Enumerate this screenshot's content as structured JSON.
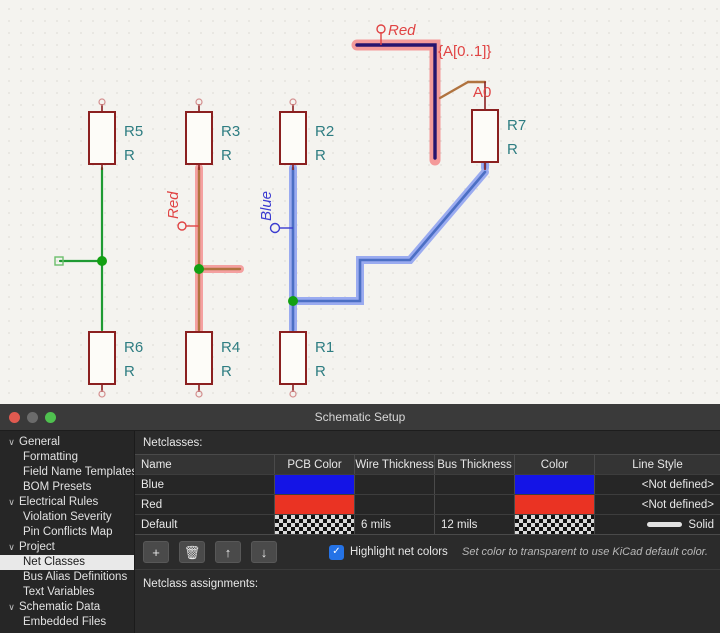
{
  "schematic": {
    "components": [
      {
        "ref": "R5",
        "value": "R"
      },
      {
        "ref": "R3",
        "value": "R"
      },
      {
        "ref": "R2",
        "value": "R"
      },
      {
        "ref": "R7",
        "value": "R"
      },
      {
        "ref": "R6",
        "value": "R"
      },
      {
        "ref": "R4",
        "value": "R"
      },
      {
        "ref": "R1",
        "value": "R"
      }
    ],
    "labels": {
      "red_top": "Red",
      "red_mid": "Red",
      "blue": "Blue",
      "bus": "{A[0..1]}",
      "bus_member": "A0"
    },
    "colors": {
      "background": "#f4f3ef",
      "grid_dot": "#c9c7c0",
      "symbol_outline": "#8b2020",
      "refdes_text": "#2e7d82",
      "net_red": "#e04343",
      "net_blue": "#3b3bd0",
      "wire_green": "#1f9a33",
      "wire_brown": "#b0733f",
      "bus_core": "#26146e",
      "junction_green": "#12a012",
      "blue_wire_highlight": "#6d84e8",
      "red_wire_highlight": "#f4a0a0"
    }
  },
  "dialog": {
    "title": "Schematic Setup",
    "window_controls": [
      "close",
      "minimize",
      "zoom"
    ],
    "sidebar": {
      "items": [
        {
          "label": "General",
          "level": 0,
          "expanded": true,
          "selected": false
        },
        {
          "label": "Formatting",
          "level": 1,
          "expanded": null,
          "selected": false
        },
        {
          "label": "Field Name Templates",
          "level": 1,
          "expanded": null,
          "selected": false
        },
        {
          "label": "BOM Presets",
          "level": 1,
          "expanded": null,
          "selected": false
        },
        {
          "label": "Electrical Rules",
          "level": 0,
          "expanded": true,
          "selected": false
        },
        {
          "label": "Violation Severity",
          "level": 1,
          "expanded": null,
          "selected": false
        },
        {
          "label": "Pin Conflicts Map",
          "level": 1,
          "expanded": null,
          "selected": false
        },
        {
          "label": "Project",
          "level": 0,
          "expanded": true,
          "selected": false
        },
        {
          "label": "Net Classes",
          "level": 1,
          "expanded": null,
          "selected": true
        },
        {
          "label": "Bus Alias Definitions",
          "level": 1,
          "expanded": null,
          "selected": false
        },
        {
          "label": "Text Variables",
          "level": 1,
          "expanded": null,
          "selected": false
        },
        {
          "label": "Schematic Data",
          "level": 0,
          "expanded": true,
          "selected": false
        },
        {
          "label": "Embedded Files",
          "level": 1,
          "expanded": null,
          "selected": false
        }
      ],
      "chevron_glyph": "∨"
    },
    "netclasses_panel": {
      "heading": "Netclasses:",
      "columns": [
        "Name",
        "PCB Color",
        "Wire Thickness",
        "Bus Thickness",
        "Color",
        "Line Style"
      ],
      "rows": [
        {
          "name": "Blue",
          "pcb_color": "#1414e6",
          "pcb_color_kind": "solid",
          "wire_thickness": "",
          "bus_thickness": "",
          "color": "#1414e6",
          "color_kind": "solid",
          "line_style": "<Not defined>",
          "line_style_has_sample": false
        },
        {
          "name": "Red",
          "pcb_color": "#ea3323",
          "pcb_color_kind": "solid",
          "wire_thickness": "",
          "bus_thickness": "",
          "color": "#ea3323",
          "color_kind": "solid",
          "line_style": "<Not defined>",
          "line_style_has_sample": false
        },
        {
          "name": "Default",
          "pcb_color": "",
          "pcb_color_kind": "transparent",
          "wire_thickness": "6 mils",
          "bus_thickness": "12 mils",
          "color": "",
          "color_kind": "transparent",
          "line_style": "Solid",
          "line_style_has_sample": true
        }
      ],
      "toolbar": {
        "add_label": "+",
        "delete_label": "🗑",
        "move_up_label": "↑",
        "move_down_label": "↓",
        "highlight_checkbox_label": "Highlight net colors",
        "highlight_checked": true,
        "check_glyph": "✓",
        "hint": "Set color to transparent to use KiCad default color."
      },
      "assignments_heading": "Netclass assignments:"
    }
  }
}
